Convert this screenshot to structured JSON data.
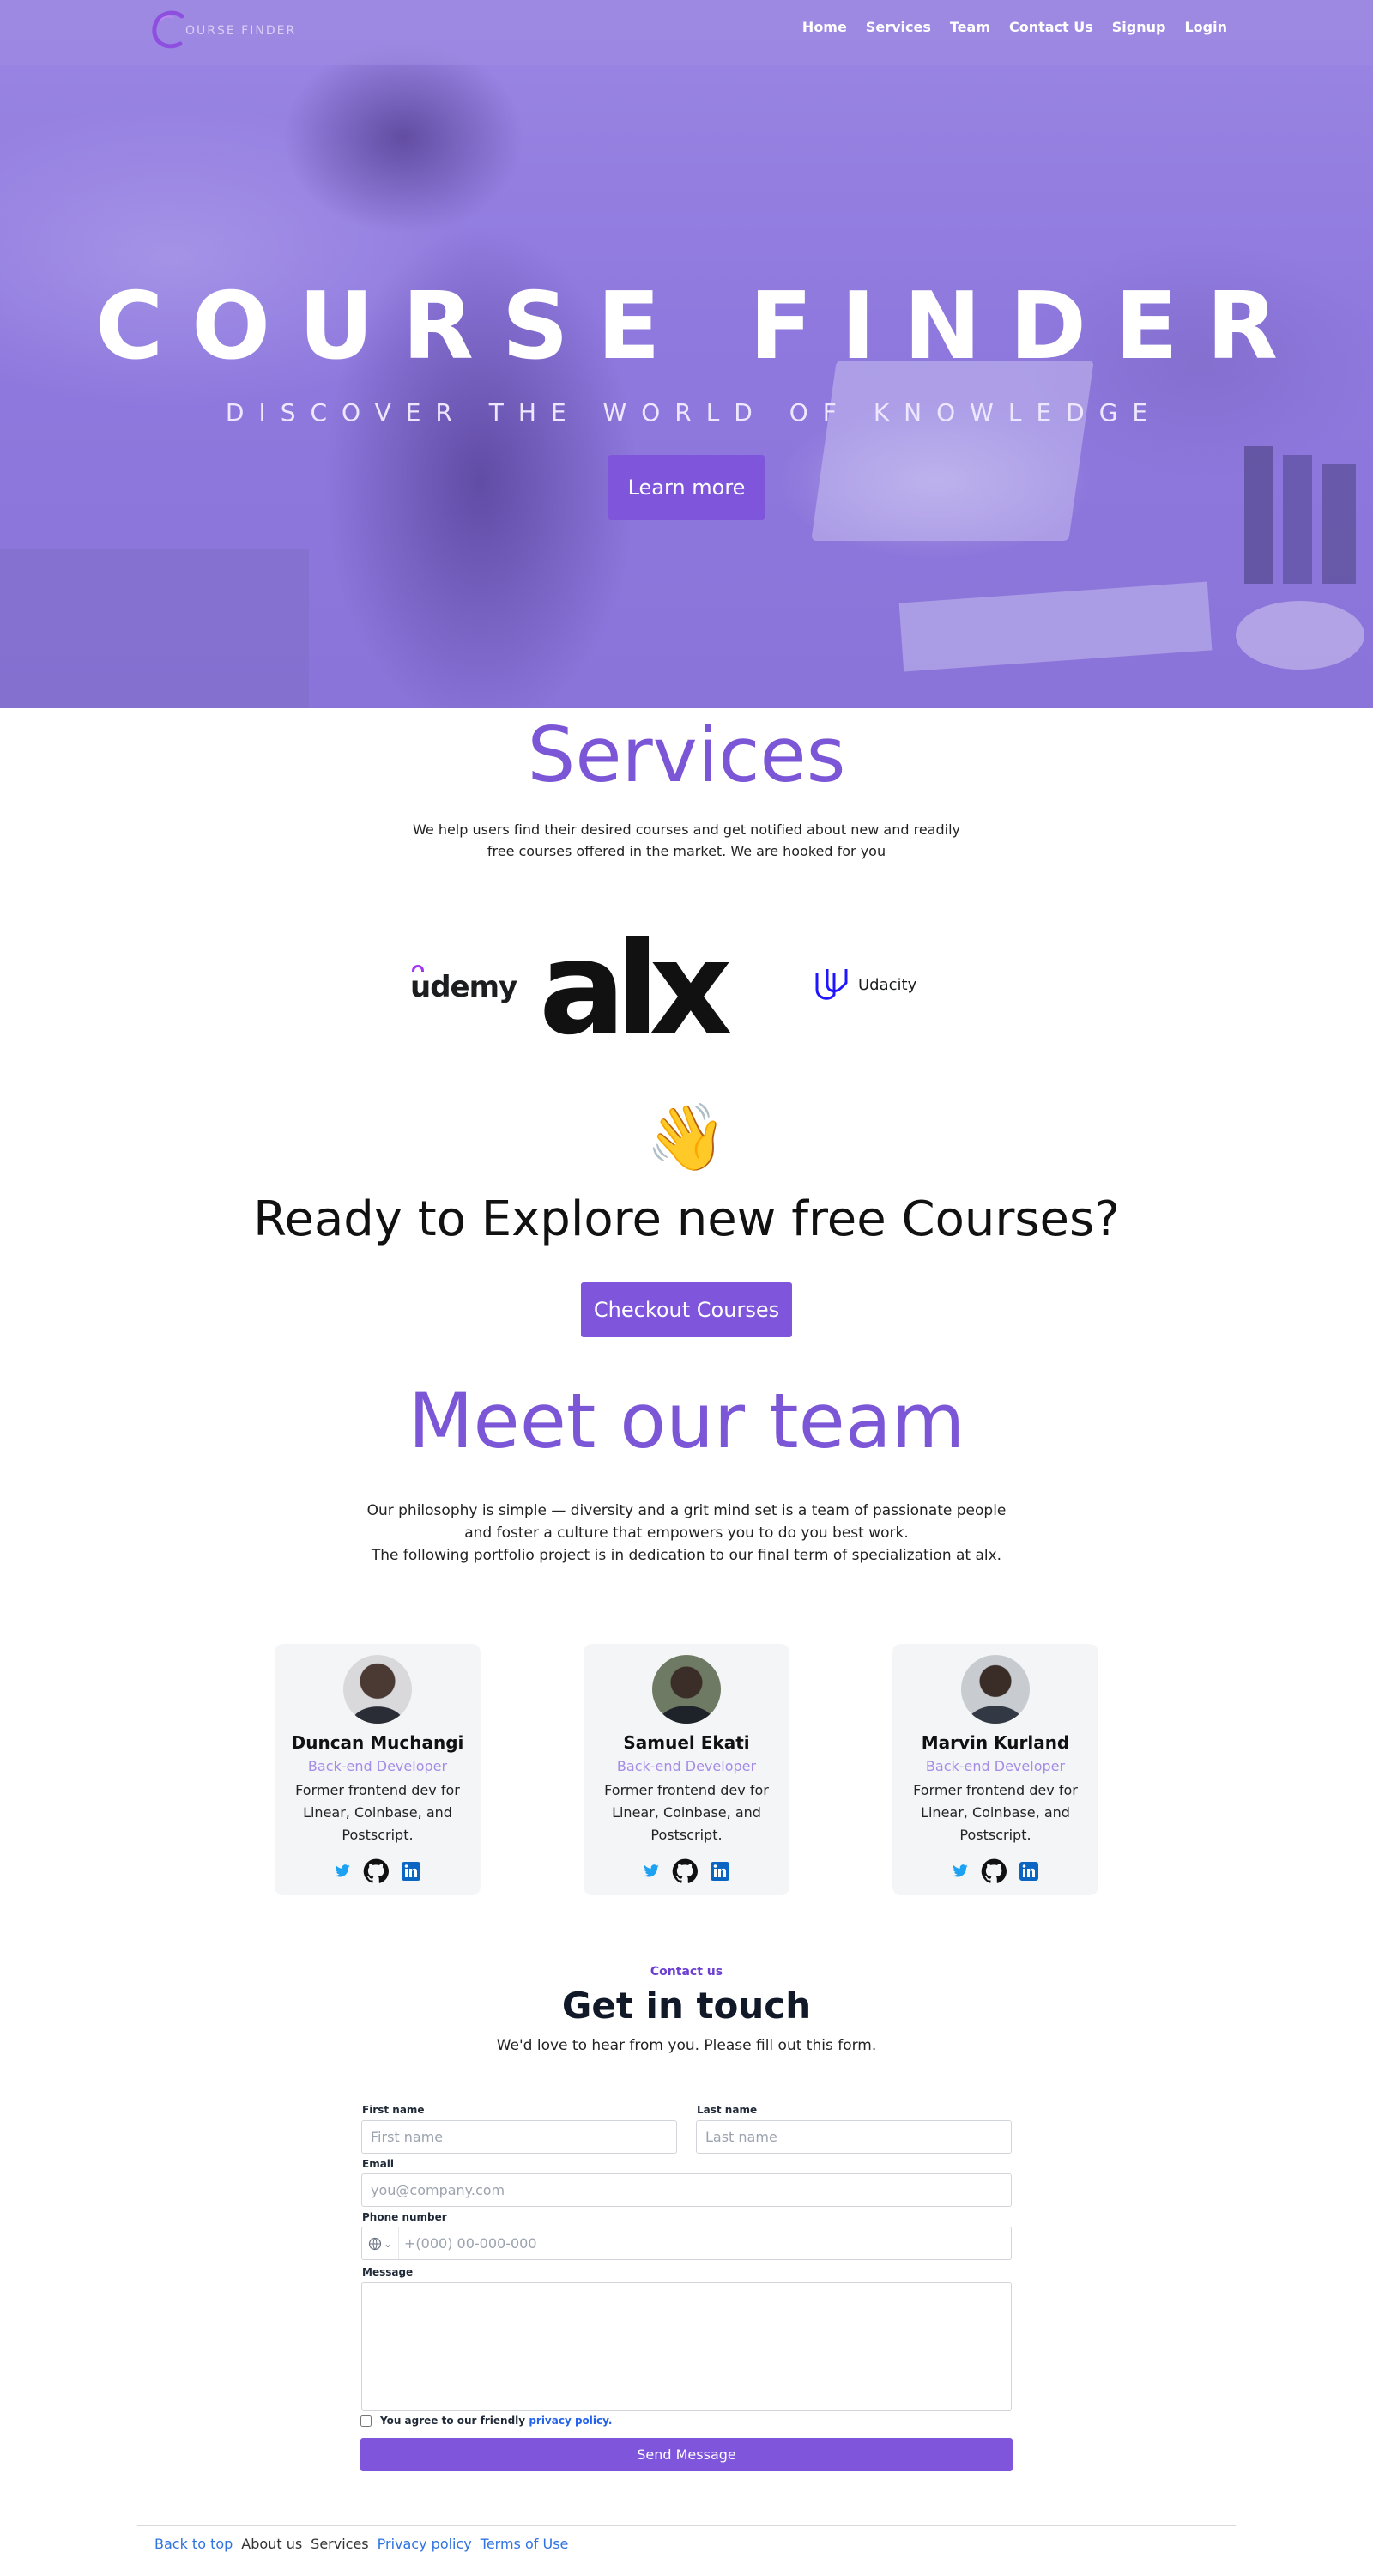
{
  "nav": {
    "brand": "OURSE FINDER",
    "links": [
      "Home",
      "Services",
      "Team",
      "Contact Us",
      "Signup",
      "Login"
    ]
  },
  "hero": {
    "title": "COURSE FINDER",
    "subtitle": "DISCOVER THE WORLD OF KNOWLEDGE",
    "button": "Learn more"
  },
  "services": {
    "title": "Services",
    "description": "We help users find their desired courses and get notified about new and readily free courses offered in the market. We are hooked for you",
    "logos": {
      "udemy": "udemy",
      "alx": "alx",
      "udacity": "Udacity"
    }
  },
  "cta": {
    "emoji": "👋",
    "title": "Ready to Explore new free Courses?",
    "button": "Checkout Courses"
  },
  "team": {
    "title": "Meet our team",
    "description_line1": "Our philosophy is simple — diversity and a grit mind set is a team of passionate people and foster a culture that empowers you to do you best work.",
    "description_line2": "The following portfolio project is in dedication to our final term of specialization at alx.",
    "members": [
      {
        "name": "Duncan Muchangi",
        "role": "Back-end Developer",
        "bio": "Former frontend dev for Linear, Coinbase, and Postscript."
      },
      {
        "name": "Samuel Ekati",
        "role": "Back-end Developer",
        "bio": "Former frontend dev for Linear, Coinbase, and Postscript."
      },
      {
        "name": "Marvin Kurland",
        "role": "Back-end Developer",
        "bio": "Former frontend dev for Linear, Coinbase, and Postscript."
      }
    ]
  },
  "contact": {
    "kicker": "Contact us",
    "title": "Get in touch",
    "subtitle": "We'd love to hear from you. Please fill out this form.",
    "first_name_label": "First name",
    "first_name_placeholder": "First name",
    "last_name_label": "Last name",
    "last_name_placeholder": "Last name",
    "email_label": "Email",
    "email_placeholder": "you@company.com",
    "phone_label": "Phone number",
    "phone_placeholder": "+(000) 00-000-000",
    "message_label": "Message",
    "agree_text": "You agree to our friendly",
    "agree_link": "privacy policy.",
    "send_button": "Send Message"
  },
  "footer": {
    "links": [
      "Back to top",
      "About us",
      "Services",
      "Privacy policy",
      "Terms of Use"
    ]
  },
  "colors": {
    "accent": "#7e55db",
    "heading_purple": "#7b56d6",
    "role_purple": "#a58de6",
    "link_blue": "#2f72e0"
  },
  "icons": [
    "course-finder-logo-icon",
    "udemy-logo",
    "alx-logo",
    "udacity-logo-icon",
    "waving-hand-emoji",
    "twitter-icon",
    "github-icon",
    "linkedin-icon",
    "phone-icon",
    "chevron-down-icon"
  ]
}
